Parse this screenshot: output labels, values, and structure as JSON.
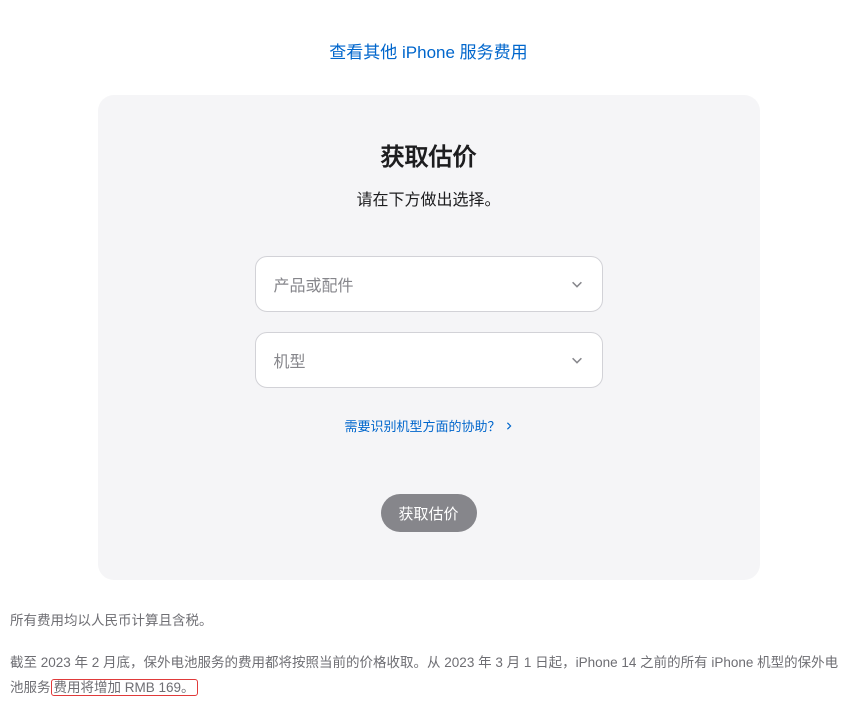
{
  "topLink": "查看其他 iPhone 服务费用",
  "card": {
    "title": "获取估价",
    "subtitle": "请在下方做出选择。",
    "dropdown1": "产品或配件",
    "dropdown2": "机型",
    "helpLink": "需要识别机型方面的协助？",
    "submitButton": "获取估价"
  },
  "disclaimer": {
    "line1": "所有费用均以人民币计算且含税。",
    "line2_pre": "截至 2023 年 2 月底，保外电池服务的费用都将按照当前的价格收取。从 2023 年 3 月 1 日起，iPhone 14 之前的所有 iPhone 机型的保外电池服务",
    "line2_highlight": "费用将增加 RMB 169。"
  }
}
